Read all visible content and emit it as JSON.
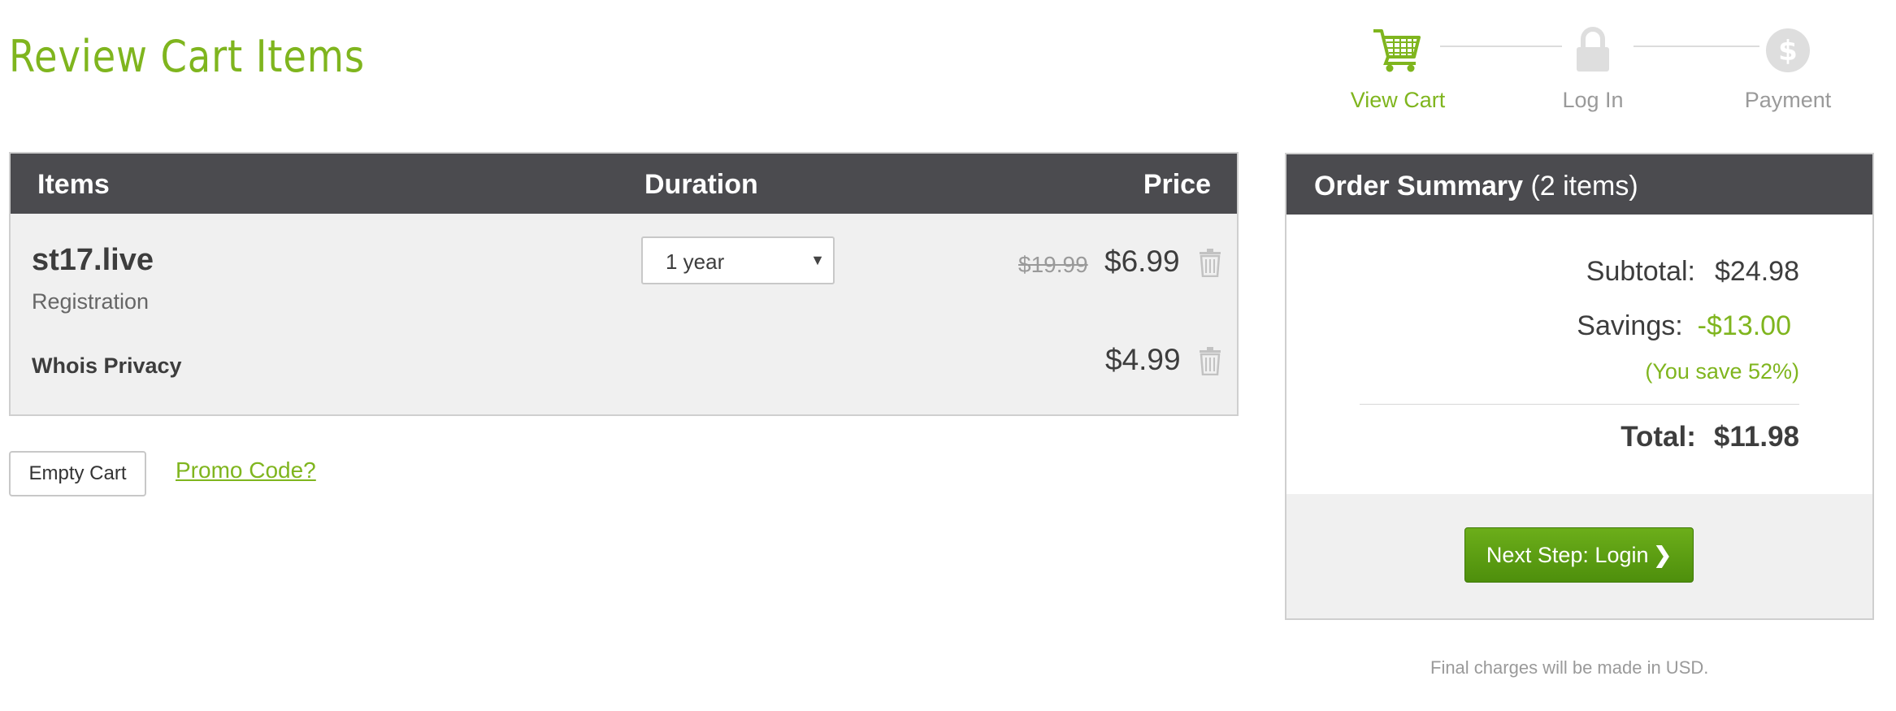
{
  "page": {
    "title": "Review Cart Items"
  },
  "steps": [
    {
      "label": "View Cart",
      "icon": "cart-icon",
      "state": "active"
    },
    {
      "label": "Log In",
      "icon": "lock-icon",
      "state": "inactive"
    },
    {
      "label": "Payment",
      "icon": "dollar-icon",
      "state": "inactive"
    }
  ],
  "cart": {
    "headers": {
      "items": "Items",
      "duration": "Duration",
      "price": "Price"
    },
    "items": [
      {
        "name": "st17.live",
        "type": "Registration",
        "duration": "1 year",
        "old_price": "$19.99",
        "price": "$6.99"
      },
      {
        "name": "Whois Privacy",
        "price": "$4.99"
      }
    ],
    "empty_label": "Empty Cart",
    "promo_label": "Promo Code?"
  },
  "summary": {
    "title": "Order Summary",
    "count": "(2 items)",
    "subtotal_label": "Subtotal:",
    "subtotal": "$24.98",
    "savings_label": "Savings:",
    "savings": "-$13.00",
    "save_pct": "(You save 52%)",
    "total_label": "Total:",
    "total": "$11.98",
    "next_label": "Next Step: Login",
    "note": "Final charges will be made in USD."
  },
  "colors": {
    "accent": "#7fb51e",
    "header_bg": "#4b4b4f",
    "button_green": "#5a9d12"
  }
}
